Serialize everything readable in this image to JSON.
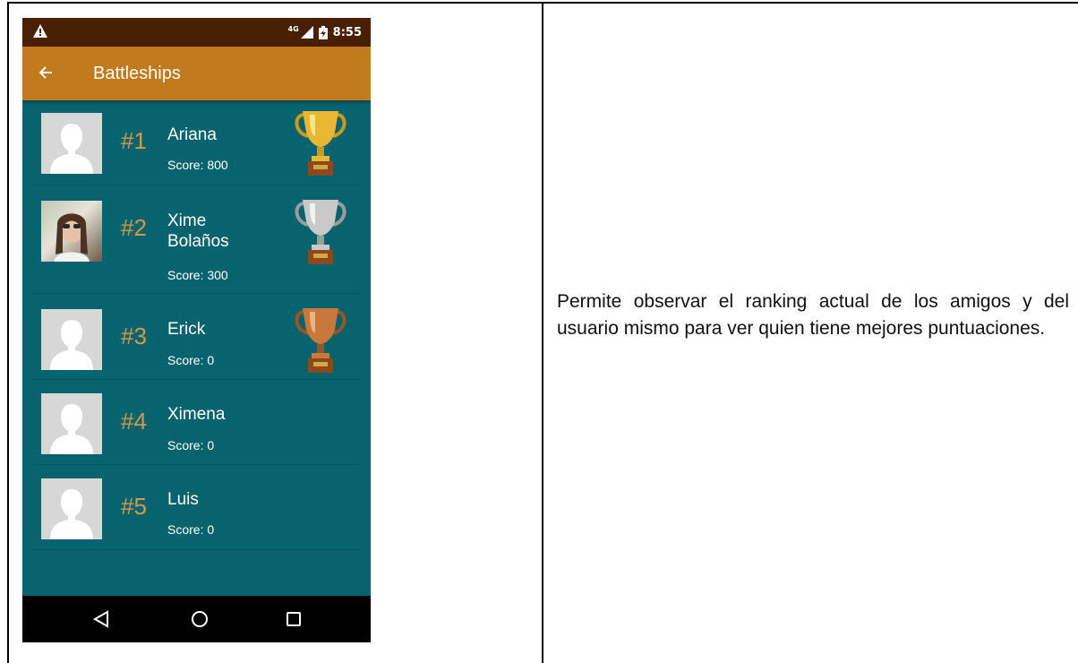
{
  "status_bar": {
    "network": "4G",
    "time": "8:55",
    "icons": [
      "warning-icon",
      "signal-icon",
      "battery-icon"
    ]
  },
  "app_bar": {
    "title": "Battleships",
    "back_icon": "arrow-back-icon"
  },
  "leaderboard": [
    {
      "rank": "#1",
      "name": "Ariana",
      "score": "Score: 800",
      "avatar": "default-avatar",
      "trophy": "gold"
    },
    {
      "rank": "#2",
      "name": "Xime Bolaños",
      "score": "Score: 300",
      "avatar": "photo",
      "trophy": "silver"
    },
    {
      "rank": "#3",
      "name": "Erick",
      "score": "Score: 0",
      "avatar": "default-avatar",
      "trophy": "bronze"
    },
    {
      "rank": "#4",
      "name": "Ximena",
      "score": "Score: 0",
      "avatar": "default-avatar",
      "trophy": null
    },
    {
      "rank": "#5",
      "name": "Luis",
      "score": "Score: 0",
      "avatar": "default-avatar",
      "trophy": null
    }
  ],
  "trophy_colors": {
    "gold": "#e8b832",
    "silver": "#c9c9c9",
    "bronze": "#c8783a"
  },
  "nav_bar": {
    "icons": [
      "nav-back-icon",
      "nav-home-icon",
      "nav-recents-icon"
    ]
  },
  "colors": {
    "status_bar": "#4a2005",
    "app_bar": "#c27a1e",
    "list_background": "#07646f",
    "rank_text": "#d39a46"
  },
  "description": {
    "text": "Permite observar el ranking actual de los amigos y del usuario mismo para ver quien tiene mejores puntuaciones."
  }
}
